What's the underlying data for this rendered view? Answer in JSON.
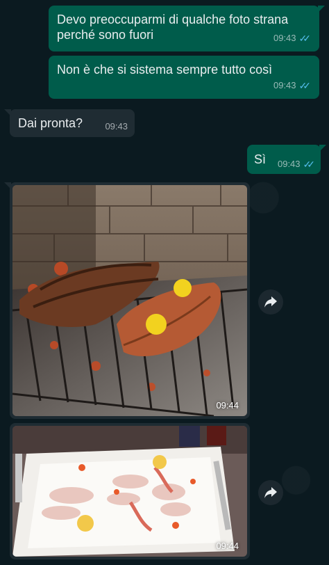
{
  "messages": [
    {
      "text": "Devo preoccuparmi di qualche foto strana perché sono fuori",
      "time": "09:43"
    },
    {
      "text": "Non è che si sistema sempre tutto così",
      "time": "09:43"
    },
    {
      "text": "Dai pronta?",
      "time": "09:43"
    },
    {
      "text": "Sì",
      "time": "09:43"
    }
  ],
  "images": [
    {
      "time": "09:44",
      "subject": "grilled steaks with lemon halves on a fireplace grill"
    },
    {
      "time": "09:44",
      "subject": "plate of raw fish carpaccio with prawns and lemon slices"
    }
  ],
  "icons": {
    "read_receipt": "double-check-icon",
    "forward": "forward-icon"
  },
  "colors": {
    "outgoing": "#005c4b",
    "incoming": "#1f2c33",
    "read": "#53bdeb"
  }
}
